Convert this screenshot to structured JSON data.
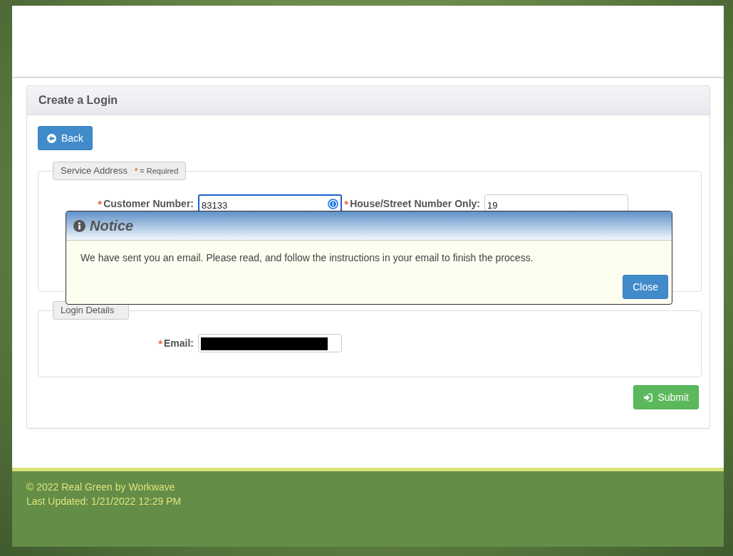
{
  "panel": {
    "title": "Create a Login"
  },
  "back_button": {
    "label": "Back"
  },
  "service_address": {
    "legend": "Service Address",
    "required_note": {
      "mark": "*",
      "text": "= Required"
    },
    "fields": [
      {
        "label": "Customer Number:",
        "required_mark": "*",
        "value": "83133",
        "focused": true
      },
      {
        "label": "House/Street Number Only:",
        "required_mark": "*",
        "value": "19",
        "focused": false
      }
    ]
  },
  "login_details": {
    "legend": "Login Details",
    "fields": [
      {
        "label": "Email:",
        "required_mark": "*",
        "redacted": true
      }
    ]
  },
  "submit_button": {
    "label": "Submit"
  },
  "notice": {
    "title": "Notice",
    "message": "We have sent you an email. Please read, and follow the instructions in your email to finish the process.",
    "close_label": "Close"
  },
  "footer": {
    "copyright": "© 2022 Real Green by Workwave",
    "last_updated": "Last Updated: 1/21/2022 12:29 PM"
  }
}
